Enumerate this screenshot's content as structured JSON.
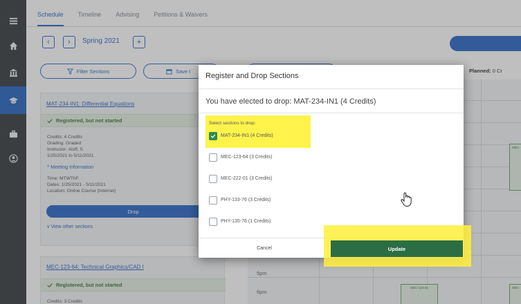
{
  "tabs": [
    {
      "label": "Schedule",
      "active": true
    },
    {
      "label": "Timeline",
      "active": false
    },
    {
      "label": "Advising",
      "active": false
    },
    {
      "label": "Petitions & Waivers",
      "active": false
    }
  ],
  "sidebar": {
    "icons": [
      "menu-icon",
      "home-icon",
      "bank-icon",
      "graduation-cap-icon",
      "briefcase-icon",
      "person-icon"
    ],
    "active_icon": "graduation-cap-icon"
  },
  "term": {
    "label": "Spring 2021",
    "prev_symbol": "‹",
    "next_symbol": "›",
    "add_symbol": "+"
  },
  "toolbar": {
    "filter_label": "Filter Sections",
    "save_label": "Save t",
    "planned_prefix": "Planned:",
    "planned_value": "0 Cr"
  },
  "courses": [
    {
      "title": "MAT-234-IN1: Differential Equations",
      "status": "Registered, but not started",
      "details": [
        "Credits: 4 Credits",
        "Grading: Graded",
        "Instructor: Aloff, S",
        "1/25/2021 to 5/11/2021"
      ],
      "meeting_toggle": "Meeting Information",
      "meeting": [
        "Time: MTWThF",
        "Dates: 1/25/2021 - 5/11/2021",
        "Location: Online Course (Internet)"
      ],
      "drop_label": "Drop",
      "view_other_label": "View other sections"
    },
    {
      "title": "MEC-123-64: Technical Graphics/CAD I",
      "status": "Registered, but not started",
      "details": [
        "Credits: 3 Credits"
      ]
    }
  ],
  "calendar": {
    "times": [
      "5pm",
      "6pm"
    ],
    "events": [
      "MEC-",
      "MEC-123-64",
      "MEC-"
    ]
  },
  "modal": {
    "title": "Register and Drop Sections",
    "subtitle": "You have elected to drop: MAT-234-IN1 (4 Credits)",
    "select_label": "Select sections to drop:",
    "sections": [
      {
        "label": "MAT-234-IN1 (4 Credits)",
        "checked": true
      },
      {
        "label": "MEC-123-64 (3 Credits)",
        "checked": false
      },
      {
        "label": "MEC-222-01 (3 Credits)",
        "checked": false
      },
      {
        "label": "PHY-133-76 (3 Credits)",
        "checked": false
      },
      {
        "label": "PHY-135-76 (1 Credits)",
        "checked": false
      }
    ],
    "cancel_label": "Cancel",
    "update_label": "Update"
  },
  "colors": {
    "accent_blue": "#2f6ac8",
    "update_green": "#2c6e43",
    "checkbox_green": "#2f8c4f",
    "highlight_yellow": "#fff34c",
    "sidebar_dark": "#3a3f44"
  }
}
